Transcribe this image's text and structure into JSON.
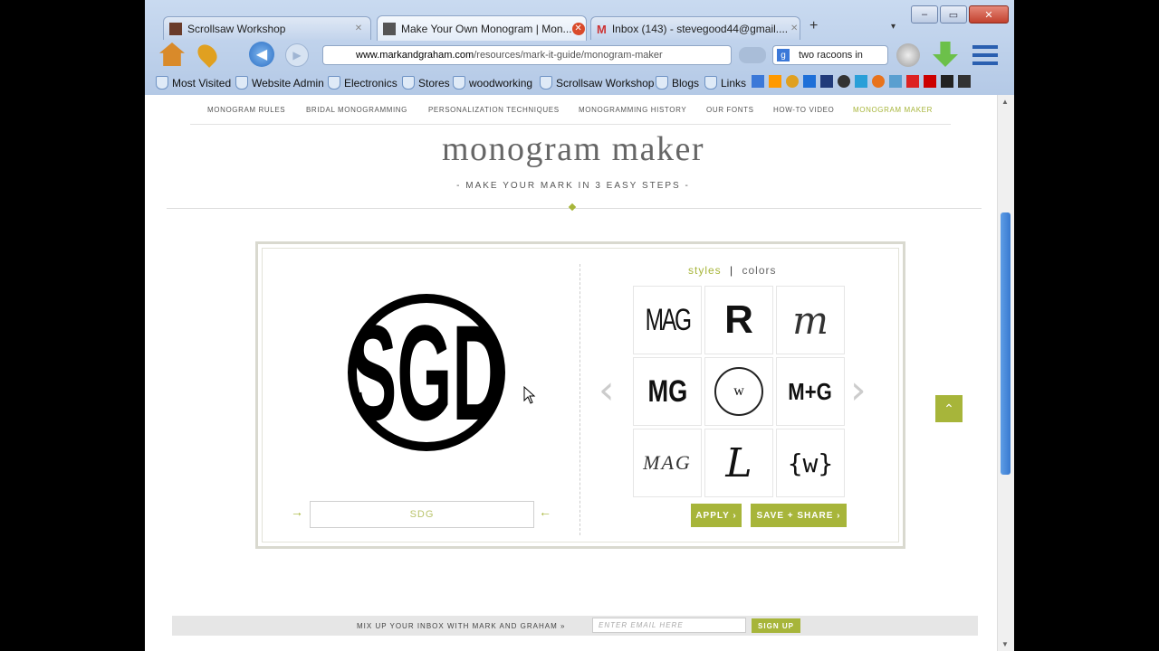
{
  "browser": {
    "tabs": [
      {
        "label": "Scrollsaw Workshop",
        "active": false
      },
      {
        "label": "Make Your Own Monogram | Mon...",
        "active": true
      },
      {
        "label": "Inbox (143) - stevegood44@gmail....",
        "active": false
      }
    ],
    "new_tab_symbol": "+",
    "url_domain": "www.markandgraham.com",
    "url_path": "/resources/mark-it-guide/monogram-maker",
    "search_value": "two racoons in",
    "bookmarks": [
      "Most Visited",
      "Website Admin",
      "Electronics",
      "Stores",
      "woodworking",
      "Scrollsaw Workshop",
      "Blogs",
      "Links"
    ]
  },
  "site_nav": [
    {
      "label": "MONOGRAM RULES",
      "active": false
    },
    {
      "label": "BRIDAL MONOGRAMMING",
      "active": false
    },
    {
      "label": "PERSONALIZATION TECHNIQUES",
      "active": false
    },
    {
      "label": "MONOGRAMMING HISTORY",
      "active": false
    },
    {
      "label": "OUR FONTS",
      "active": false
    },
    {
      "label": "HOW-TO VIDEO",
      "active": false
    },
    {
      "label": "MONOGRAM MAKER",
      "active": true
    }
  ],
  "page": {
    "title": "monogram maker",
    "subtitle": "- MAKE YOUR MARK IN 3 EASY STEPS -"
  },
  "maker": {
    "preview_text": "SGD",
    "input_value": "SDG",
    "style_tabs": {
      "styles": "styles",
      "separator": "|",
      "colors": "colors"
    },
    "styles": [
      "MAG",
      "R",
      "m",
      "MG",
      "w",
      "M+G",
      "MAG",
      "L",
      "{w}"
    ],
    "apply_label": "APPLY ›",
    "save_label": "SAVE + SHARE ›",
    "accent_color": "#a7b53a"
  },
  "footer": {
    "message": "MIX UP YOUR INBOX WITH MARK AND GRAHAM »",
    "email_placeholder": "ENTER EMAIL HERE",
    "signup_label": "SIGN UP"
  }
}
